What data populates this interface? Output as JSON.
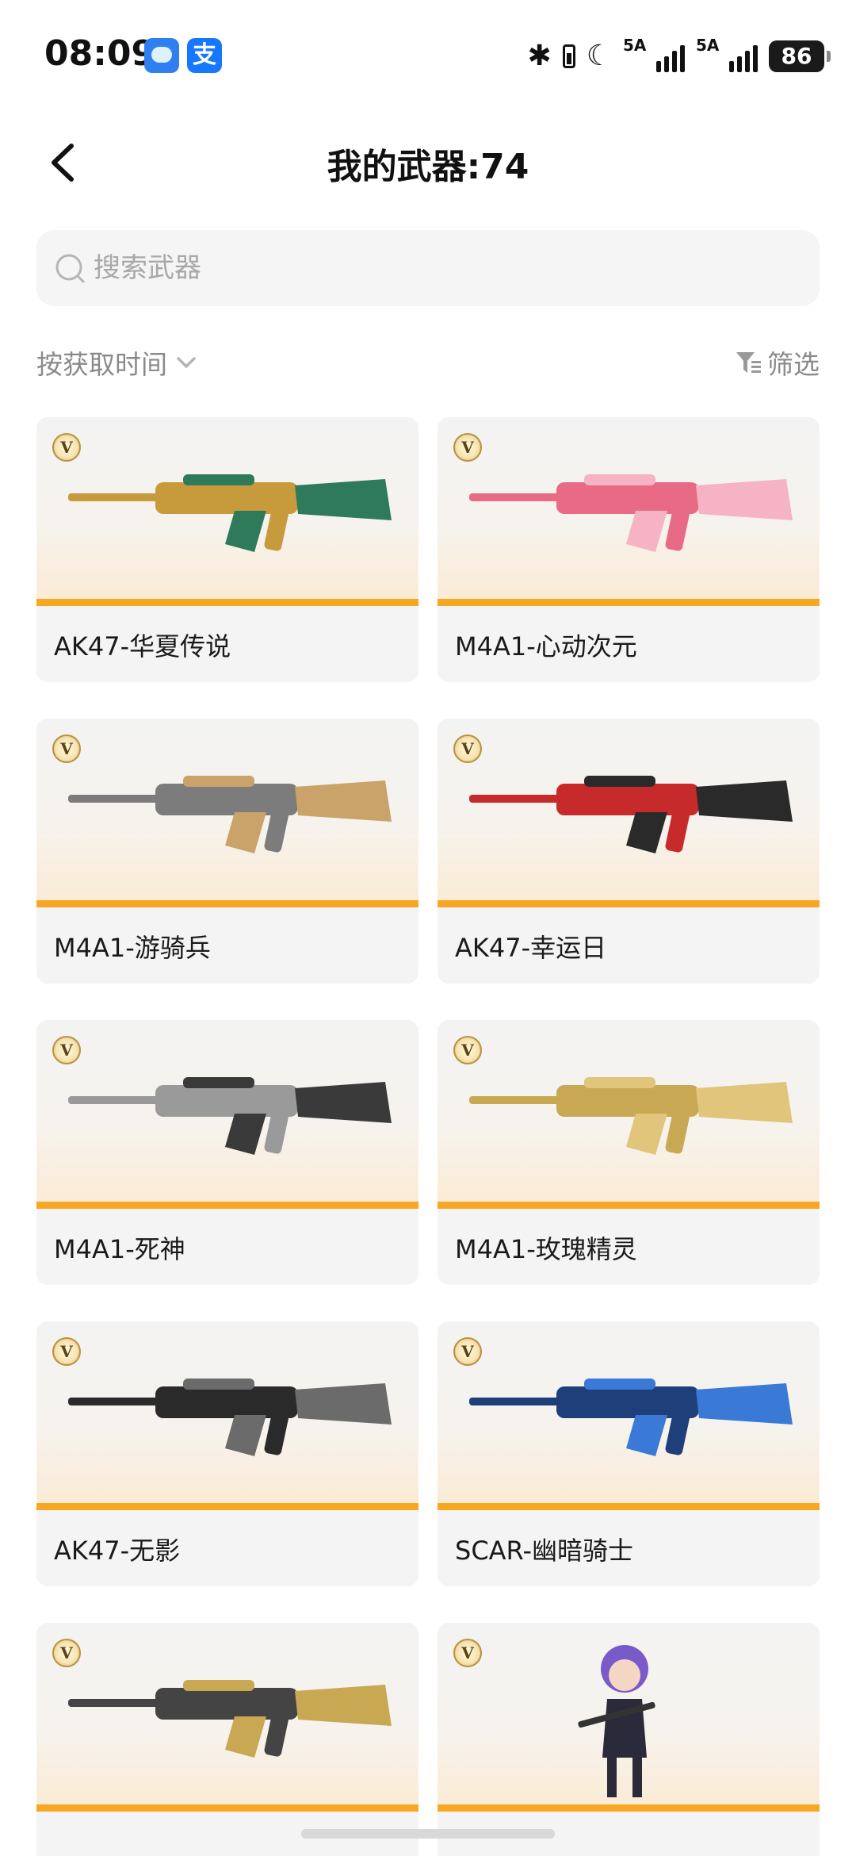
{
  "status_bar": {
    "time": "08:09",
    "net_label_1": "5A",
    "net_label_2": "5A",
    "battery": "86",
    "icons": [
      "message-app-icon",
      "alipay-icon",
      "bluetooth-icon",
      "battery-saver-icon",
      "moon-icon",
      "signal-icon",
      "signal-icon",
      "battery-icon"
    ]
  },
  "header": {
    "title": "我的武器:74",
    "back_icon": "chevron-left-icon"
  },
  "search": {
    "placeholder": "搜索武器",
    "value": ""
  },
  "toolbar": {
    "sort_label": "按获取时间",
    "filter_label": "筛选"
  },
  "weapons": [
    {
      "name": "AK47-华夏传说",
      "badge": "V",
      "colors": [
        "#c79a3c",
        "#2f7a5a"
      ]
    },
    {
      "name": "M4A1-心动次元",
      "badge": "V",
      "colors": [
        "#e96a85",
        "#f5b3c3"
      ]
    },
    {
      "name": "M4A1-游骑兵",
      "badge": "V",
      "colors": [
        "#7c7c7c",
        "#c9a36a"
      ]
    },
    {
      "name": "AK47-幸运日",
      "badge": "V",
      "colors": [
        "#c62a2a",
        "#2a2a2a"
      ]
    },
    {
      "name": "M4A1-死神",
      "badge": "V",
      "colors": [
        "#9a9a9a",
        "#3a3a3a"
      ]
    },
    {
      "name": "M4A1-玫瑰精灵",
      "badge": "V",
      "colors": [
        "#c9a854",
        "#e0c57a"
      ]
    },
    {
      "name": "AK47-无影",
      "badge": "V",
      "colors": [
        "#2a2a2a",
        "#6b6b6b"
      ]
    },
    {
      "name": "SCAR-幽暗骑士",
      "badge": "V",
      "colors": [
        "#1f3f7a",
        "#3a7ad6"
      ]
    },
    {
      "name": "",
      "badge": "V",
      "colors": [
        "#444444",
        "#c9a854"
      ]
    },
    {
      "name": "",
      "badge": "V",
      "colors": [
        "#7a5ac8",
        "#2a2a3a"
      ]
    }
  ],
  "colors": {
    "accent_bar": "#f8a722",
    "card_bg": "#f4f4f4",
    "search_bg": "#f5f5f5",
    "muted_text": "#8a8a8a"
  }
}
